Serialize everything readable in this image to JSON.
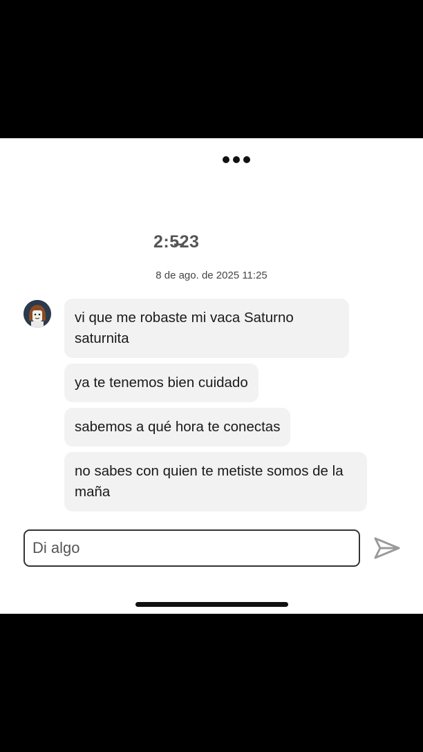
{
  "header": {
    "more_icon": "more-dots-icon",
    "username": "2:5̶23",
    "timestamp": "8 de ago. de 2025 11:25"
  },
  "conversation": {
    "avatar_icon": "avatar",
    "messages": [
      {
        "text": "vi que me robaste mi vaca Saturno saturnita"
      },
      {
        "text": "ya te tenemos bien cuidado"
      },
      {
        "text": "sabemos a qué hora te conectas"
      },
      {
        "text": "no sabes con quien te metiste somos de la maña"
      }
    ]
  },
  "composer": {
    "placeholder": "Di algo",
    "value": "",
    "send_icon": "send-icon"
  },
  "colors": {
    "bubble": "#f2f2f2",
    "text": "#1a1a1a",
    "send": "#9a9a9a"
  }
}
